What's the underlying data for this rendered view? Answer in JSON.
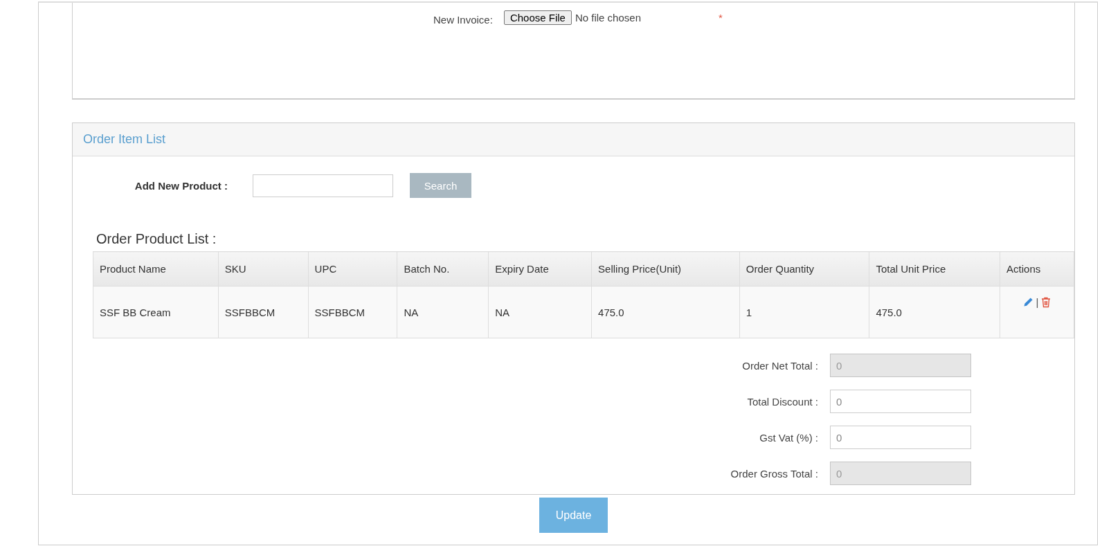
{
  "invoice": {
    "label": "New Invoice:",
    "button": "Choose File",
    "status": "No file chosen",
    "required_mark": "*"
  },
  "order_item_list": {
    "title": "Order Item List",
    "add_product": {
      "label": "Add New Product :",
      "button": "Search"
    },
    "product_list_title": "Order Product List :",
    "table": {
      "columns": [
        "Product Name",
        "SKU",
        "UPC",
        "Batch No.",
        "Expiry Date",
        "Selling Price(Unit)",
        "Order Quantity",
        "Total Unit Price",
        "Actions"
      ],
      "rows": [
        {
          "cells": [
            "SSF BB Cream",
            "SSFBBCM",
            "SSFBBCM",
            "NA",
            "NA",
            "475.0",
            "1",
            "475.0"
          ],
          "action_separator": "|"
        }
      ]
    },
    "totals": [
      {
        "label": "Order Net Total :",
        "value": "0",
        "disabled": true
      },
      {
        "label": "Total Discount :",
        "value": "0",
        "disabled": false
      },
      {
        "label": "Gst Vat (%) :",
        "value": "0",
        "disabled": false
      },
      {
        "label": "Order Gross Total :",
        "value": "0",
        "disabled": true
      }
    ]
  },
  "update_button": "Update"
}
